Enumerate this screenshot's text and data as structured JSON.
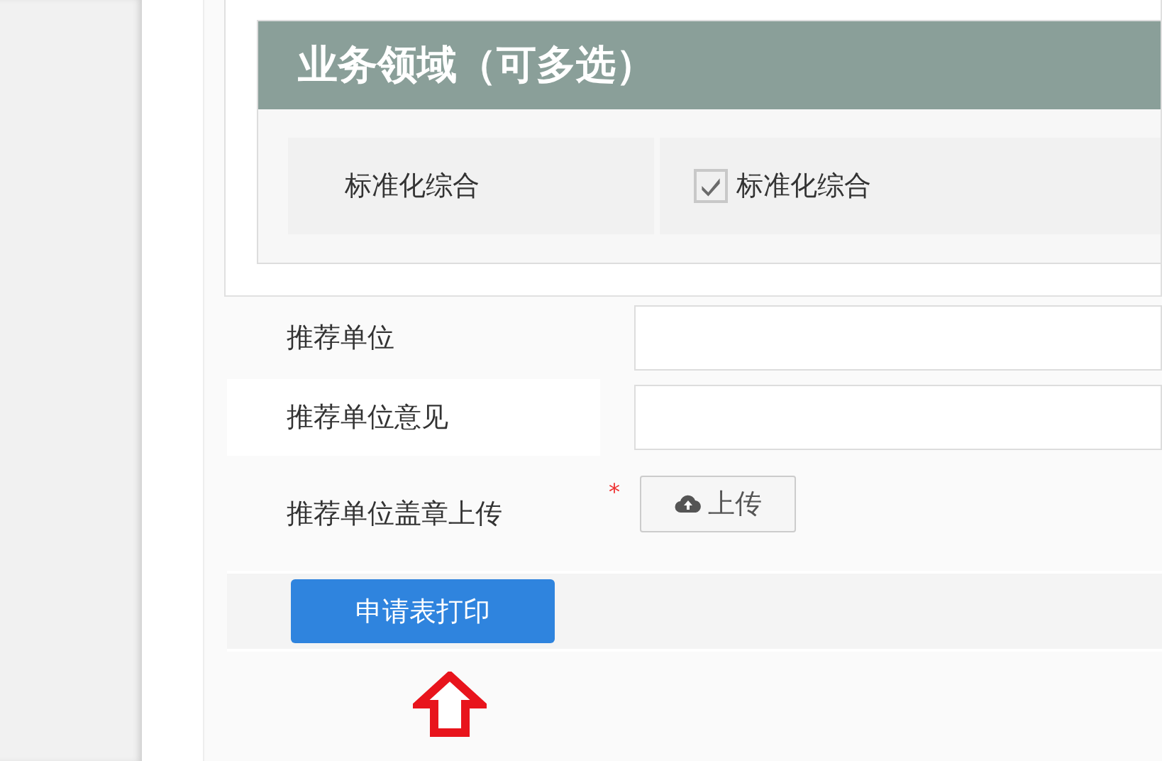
{
  "section": {
    "title": "业务领域（可多选）",
    "rows": [
      {
        "label": "标准化综合",
        "options": [
          {
            "label": "标准化综合",
            "checked": true
          }
        ]
      }
    ]
  },
  "fields": [
    {
      "kind": "text",
      "label": "推荐单位"
    },
    {
      "kind": "text",
      "label": "推荐单位意见"
    },
    {
      "kind": "upload",
      "label": "推荐单位盖章上传",
      "required_mark": "*",
      "button": "上传"
    }
  ],
  "print_button": "申请表打印"
}
